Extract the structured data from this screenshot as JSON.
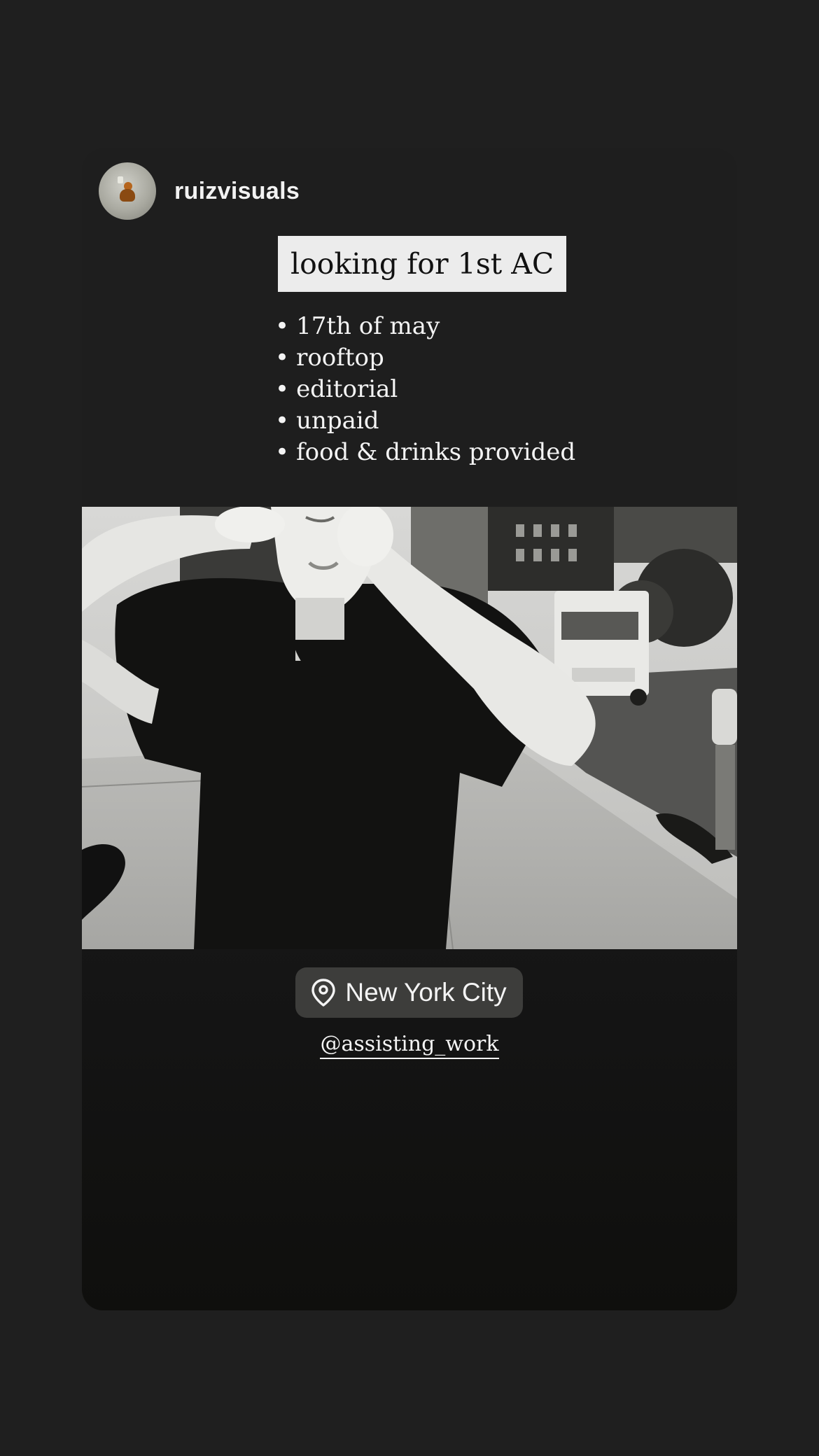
{
  "story": {
    "username": "ruizvisuals",
    "title": "looking for 1st AC",
    "bullet_marker": "•",
    "bullets": [
      "17th of may",
      "rooftop",
      "editorial",
      "unpaid",
      "food & drinks provided"
    ],
    "location": "New York City",
    "mention": "@assisting_work"
  },
  "icons": {
    "location": "location-pin-icon"
  },
  "colors": {
    "background": "#1f1f1f",
    "card": "#1e1e1e",
    "title_box": "#ececec",
    "pill": "#3d3d3b",
    "text": "#f4f4f4"
  }
}
